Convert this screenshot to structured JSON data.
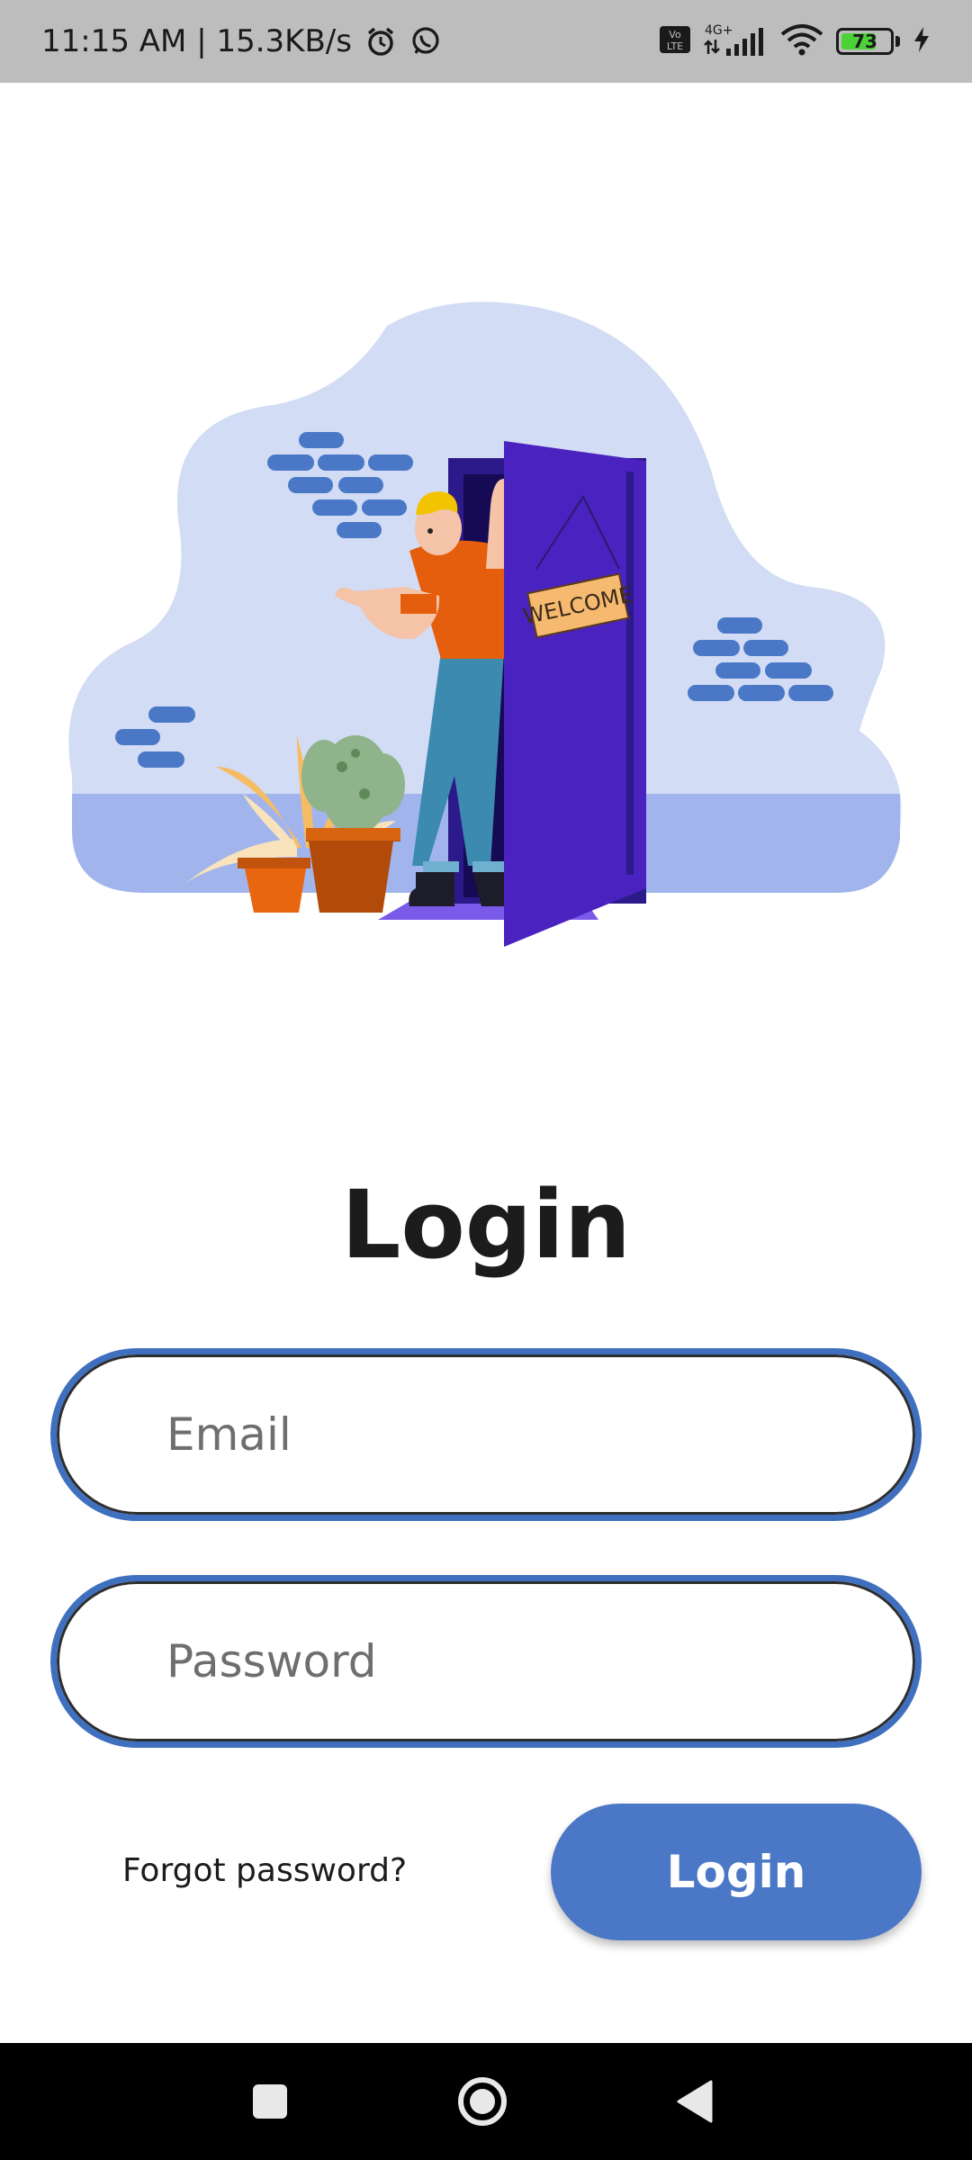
{
  "status_bar": {
    "time_speed": "11:15 AM | 15.3KB/s",
    "alarm_icon": "alarm-clock-icon",
    "whatsapp_icon": "whatsapp-icon",
    "volte_label": "Vo LTE",
    "network_label": "4G+",
    "battery_level": "73",
    "battery_fraction": 0.73
  },
  "illustration": {
    "sign_text": "WELCOME"
  },
  "title": "Login",
  "email": {
    "placeholder": "Email",
    "value": ""
  },
  "password": {
    "placeholder": "Password",
    "value": ""
  },
  "forgot_label": "Forgot password?",
  "login_button_label": "Login",
  "nav": {
    "recents_icon": "square-recents-icon",
    "home_icon": "circle-home-icon",
    "back_icon": "triangle-back-icon"
  },
  "colors": {
    "accent": "#4a78c6",
    "field_border": "#3f6fbf",
    "door": "#4a22c0",
    "blob": "#d3dcf5"
  }
}
